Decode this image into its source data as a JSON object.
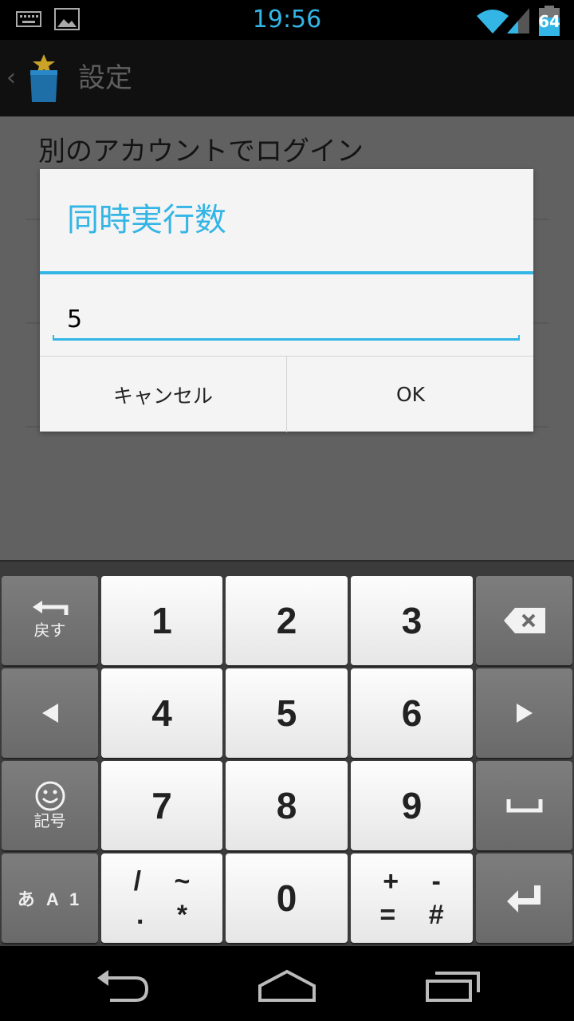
{
  "status_bar": {
    "time": "19:56",
    "battery_level": "64",
    "icons": [
      "keyboard-notification-icon",
      "image-notification-icon",
      "wifi-icon",
      "signal-icon",
      "battery-icon"
    ]
  },
  "action_bar": {
    "up_glyph": "‹",
    "title": "設定",
    "app_icon": "app-icon"
  },
  "content": {
    "pref_title": "別のアカウントでログイン"
  },
  "dialog": {
    "title": "同時実行数",
    "input_value": "5",
    "cancel_label": "キャンセル",
    "ok_label": "OK"
  },
  "keyboard": {
    "back_label": "戻す",
    "symbol_label": "記号",
    "mode_label": "あ A 1",
    "digits": [
      "1",
      "2",
      "3",
      "4",
      "5",
      "6",
      "7",
      "8",
      "9",
      "0"
    ],
    "sym_key_top": "/ ~",
    "sym_key_bottom": ". *",
    "op_key_top": "+ -",
    "op_key_bottom": "= #"
  },
  "colors": {
    "accent": "#33b5e5",
    "dim_background": "#616161",
    "dialog_background": "#f4f4f4"
  },
  "nav_bar": {
    "icons": [
      "back-icon",
      "home-icon",
      "recents-icon"
    ]
  }
}
